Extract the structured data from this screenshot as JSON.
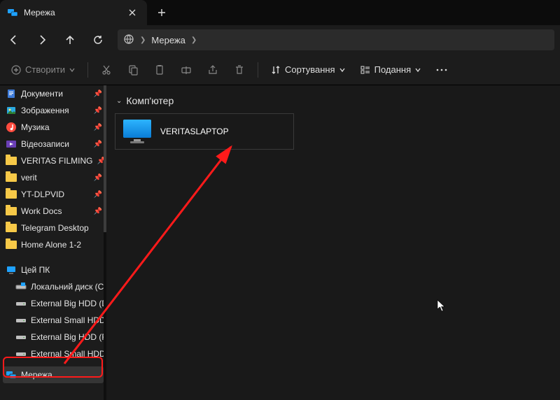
{
  "tab": {
    "title": "Мережа"
  },
  "address": {
    "root": "Мережа"
  },
  "toolbar": {
    "create": "Створити",
    "sort": "Сортування",
    "view": "Подання"
  },
  "sidebar": {
    "quick": [
      {
        "label": "Документи",
        "icon": "docs",
        "pin": true
      },
      {
        "label": "Зображення",
        "icon": "pictures",
        "pin": true
      },
      {
        "label": "Музика",
        "icon": "music",
        "pin": true
      },
      {
        "label": "Відеозаписи",
        "icon": "videos",
        "pin": true
      },
      {
        "label": "VERITAS FILMING",
        "icon": "folder",
        "pin": true
      },
      {
        "label": "verit",
        "icon": "folder",
        "pin": true
      },
      {
        "label": "YT-DLPVID",
        "icon": "folder",
        "pin": true
      },
      {
        "label": "Work Docs",
        "icon": "folder",
        "pin": true
      },
      {
        "label": "Telegram Desktop",
        "icon": "folder",
        "pin": false
      },
      {
        "label": "Home Alone 1-2",
        "icon": "folder",
        "pin": false
      }
    ],
    "thispc": {
      "label": "Цей ПК",
      "children": [
        {
          "label": "Локальний диск (C:)",
          "icon": "osdrive"
        },
        {
          "label": "External Big HDD (D:)",
          "icon": "drive"
        },
        {
          "label": "External Small HDD (E:)",
          "icon": "drive"
        },
        {
          "label": "External Big HDD (F:)",
          "icon": "drive"
        },
        {
          "label": "External Small HDD (G:)",
          "icon": "drive"
        }
      ]
    },
    "network": {
      "label": "Мережа"
    }
  },
  "main": {
    "section": "Комп'ютер",
    "computer": "VERITASLAPTOP"
  }
}
